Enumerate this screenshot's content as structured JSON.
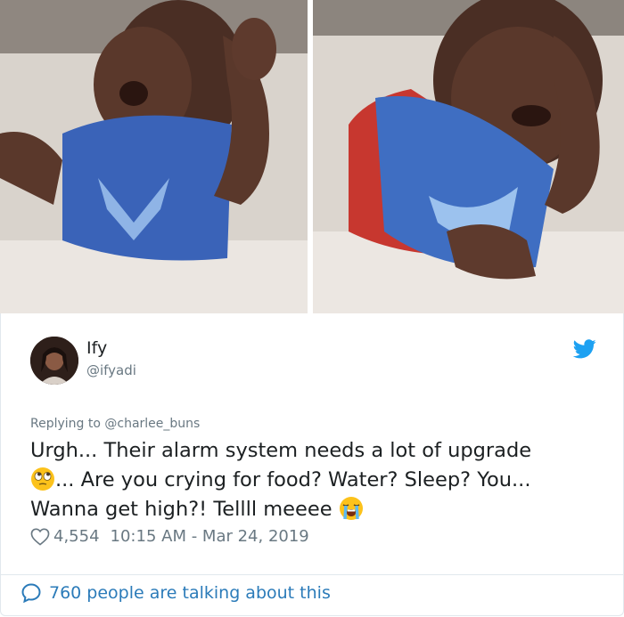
{
  "tweet": {
    "display_name": "Ify",
    "handle": "@ifyadi",
    "replying_prefix": "Replying to ",
    "replying_to": "@charlee_buns",
    "text_line1": "Urgh... Their alarm system needs a lot of upgrade",
    "text_line2": "... Are you crying for food? Water? Sleep? You...",
    "text_line3": "Wanna get high?! Tellll meeee",
    "likes": "4,554",
    "timestamp": "10:15 AM - Mar 24, 2019",
    "talking": "760 people are talking about this"
  },
  "icons": {
    "brand": "twitter-bird-icon",
    "like": "heart-icon",
    "conversation": "speech-bubble-icon",
    "emoji1": "eye-roll-emoji",
    "emoji2": "loudly-crying-emoji"
  },
  "colors": {
    "link": "#2b7bb9",
    "twitter_blue": "#1da1f2",
    "secondary_text": "#697882",
    "border": "#e1e8ed"
  }
}
